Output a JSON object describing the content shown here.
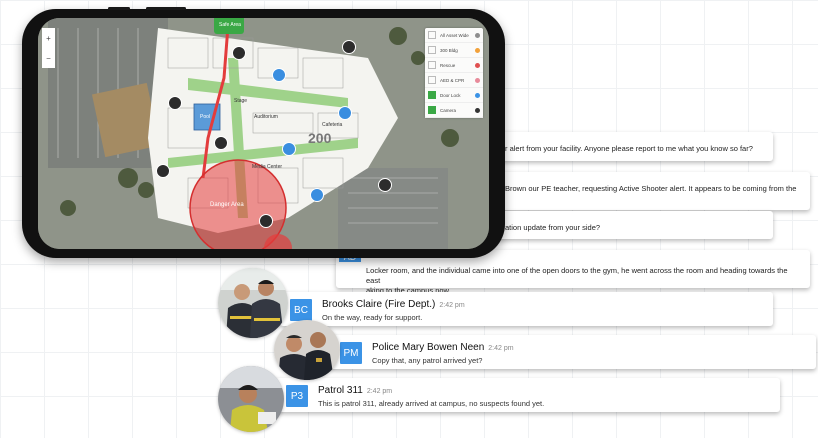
{
  "map": {
    "safe_area_label": "Safe Area",
    "danger_area_label": "Danger Area",
    "building_labels": {
      "stage": "Stage",
      "auditorium": "Auditorium",
      "cafeteria": "Cafeteria",
      "media_center": "Media Center",
      "room_200": "200",
      "pool": "Pool"
    },
    "zoom_in": "+",
    "zoom_out": "−",
    "legend": [
      {
        "label": "All Asset Wide",
        "checked": false,
        "color": "#8e8e8e"
      },
      {
        "label": "300 Bldg",
        "checked": false,
        "color": "#f2a13a"
      },
      {
        "label": "Rescue",
        "checked": false,
        "color": "#e05050"
      },
      {
        "label": "AED & CPR",
        "checked": false,
        "color": "#e88a9a"
      },
      {
        "label": "Door Lock",
        "checked": true,
        "color": "#3b93e6"
      },
      {
        "label": "Camera",
        "checked": true,
        "color": "#333333"
      }
    ]
  },
  "chat": {
    "messages": [
      {
        "text": "r alert from your facility. Anyone please report to me what you know so far?"
      },
      {
        "text": "Brown our PE teacher, requesting Active Shooter alert. It appears to be coming from the"
      },
      {
        "text": "ation update from your side?"
      },
      {
        "text": "Locker room, and the individual came into one of the open doors to the gym, he went across the room and heading towards the east",
        "text2": "aking to the campus now."
      },
      {
        "initials": "BC",
        "name": "Brooks Claire (Fire Dept.)",
        "time": "2:42 pm",
        "body": "On the way, ready for support."
      },
      {
        "initials": "PM",
        "name": "Police Mary Bowen Neen",
        "time": "2:42 pm",
        "body": "Copy that, any patrol arrived yet?"
      },
      {
        "initials": "P3",
        "name": "Patrol 311",
        "time": "2:42 pm",
        "body": "This is patrol 311, already arrived at campus, no suspects found yet."
      }
    ],
    "partial_avatar": "AD"
  }
}
